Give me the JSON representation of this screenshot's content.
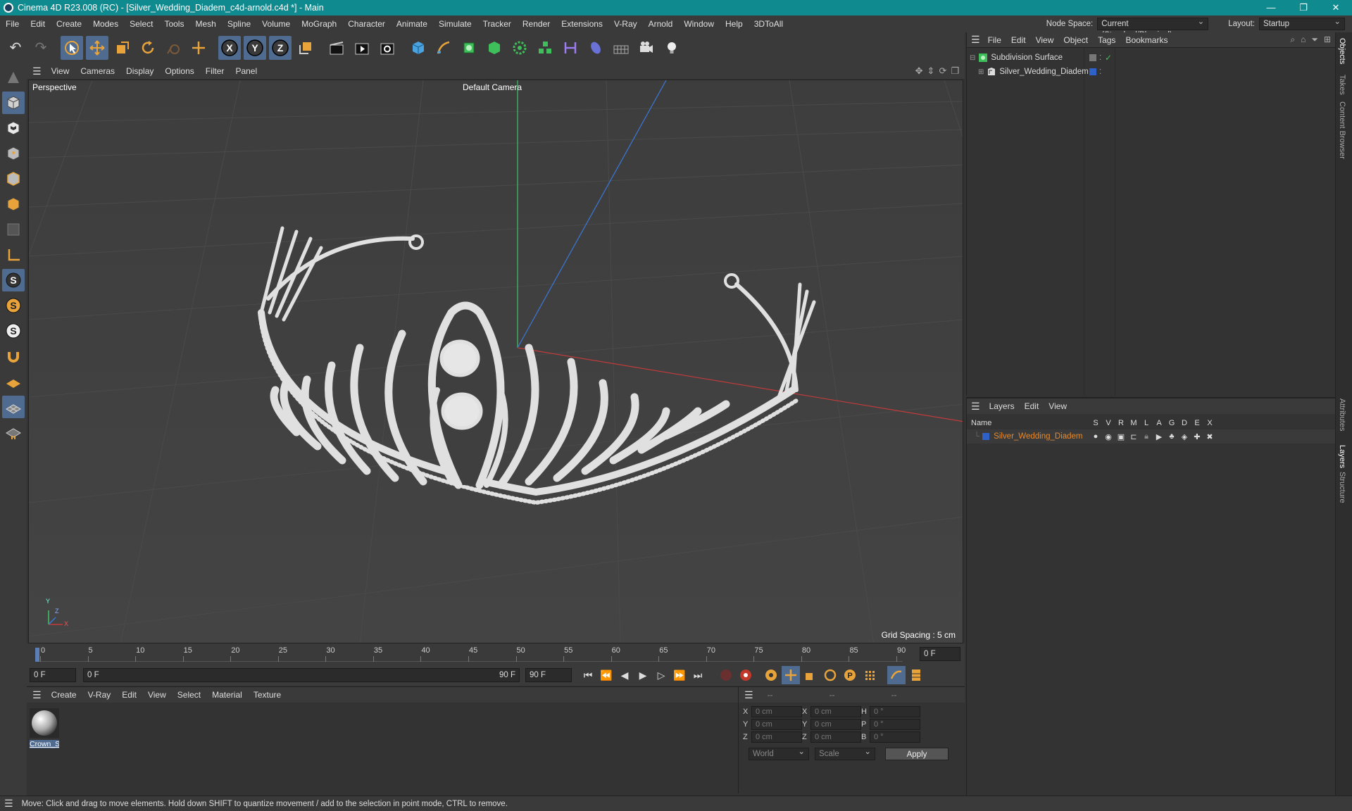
{
  "window": {
    "title": "Cinema 4D R23.008 (RC) - [Silver_Wedding_Diadem_c4d-arnold.c4d *] - Main",
    "controls": [
      "—",
      "❐",
      "✕"
    ]
  },
  "menubar": {
    "items": [
      "File",
      "Edit",
      "Create",
      "Modes",
      "Select",
      "Tools",
      "Mesh",
      "Spline",
      "Volume",
      "MoGraph",
      "Character",
      "Animate",
      "Simulate",
      "Tracker",
      "Render",
      "Extensions",
      "V-Ray",
      "Arnold",
      "Window",
      "Help",
      "3DToAll"
    ],
    "node_space_label": "Node Space:",
    "node_space_value": "Current (Standard/Physical)",
    "layout_label": "Layout:",
    "layout_value": "Startup"
  },
  "viewport": {
    "menu": [
      "View",
      "Cameras",
      "Display",
      "Options",
      "Filter",
      "Panel"
    ],
    "label": "Perspective",
    "camera": "Default Camera",
    "grid_spacing": "Grid Spacing : 5 cm",
    "axis_labels": {
      "y": "Y",
      "z": "Z",
      "x": "X"
    }
  },
  "timeline": {
    "ticks": [
      "0",
      "5",
      "10",
      "15",
      "20",
      "25",
      "30",
      "35",
      "40",
      "45",
      "50",
      "55",
      "60",
      "65",
      "70",
      "75",
      "80",
      "85",
      "90"
    ],
    "current_frame": "0 F"
  },
  "transport": {
    "start_field": "0 F",
    "range_start": "0 F",
    "range_end": "90 F",
    "end_field": "90 F"
  },
  "materials": {
    "menu": [
      "Create",
      "V-Ray",
      "Edit",
      "View",
      "Select",
      "Material",
      "Texture"
    ],
    "items": [
      {
        "label": "Crown_S"
      }
    ]
  },
  "coords": {
    "headers": [
      "--",
      "--",
      "--"
    ],
    "rows": [
      {
        "a": "X",
        "av": "0 cm",
        "b": "X",
        "bv": "0 cm",
        "c": "H",
        "cv": "0 °"
      },
      {
        "a": "Y",
        "av": "0 cm",
        "b": "Y",
        "bv": "0 cm",
        "c": "P",
        "cv": "0 °"
      },
      {
        "a": "Z",
        "av": "0 cm",
        "b": "Z",
        "bv": "0 cm",
        "c": "B",
        "cv": "0 °"
      }
    ],
    "world": "World",
    "scale": "Scale",
    "apply": "Apply"
  },
  "objects": {
    "menu": [
      "File",
      "Edit",
      "View",
      "Object",
      "Tags",
      "Bookmarks"
    ],
    "tree": [
      {
        "name": "Subdivision Surface",
        "color": "#dddddd"
      },
      {
        "name": "Silver_Wedding_Diadem",
        "color": "#dddddd"
      }
    ]
  },
  "layers": {
    "menu": [
      "Layers",
      "Edit",
      "View"
    ],
    "col_name": "Name",
    "flags": [
      "S",
      "V",
      "R",
      "M",
      "L",
      "A",
      "G",
      "D",
      "E",
      "X"
    ],
    "rows": [
      {
        "name": "Silver_Wedding_Diadem",
        "color": "#e58a2e",
        "swatch": "#2e62c9"
      }
    ]
  },
  "side_tabs": [
    "Objects",
    "Takes",
    "Content Browser",
    "Attributes",
    "Layers",
    "Structure"
  ],
  "status": "Move: Click and drag to move elements. Hold down SHIFT to quantize movement / add to the selection in point mode, CTRL to remove.",
  "colors": {
    "titlebar": "#0f8a8f",
    "accent": "#e58a2e",
    "selected": "#4f6b8f"
  }
}
